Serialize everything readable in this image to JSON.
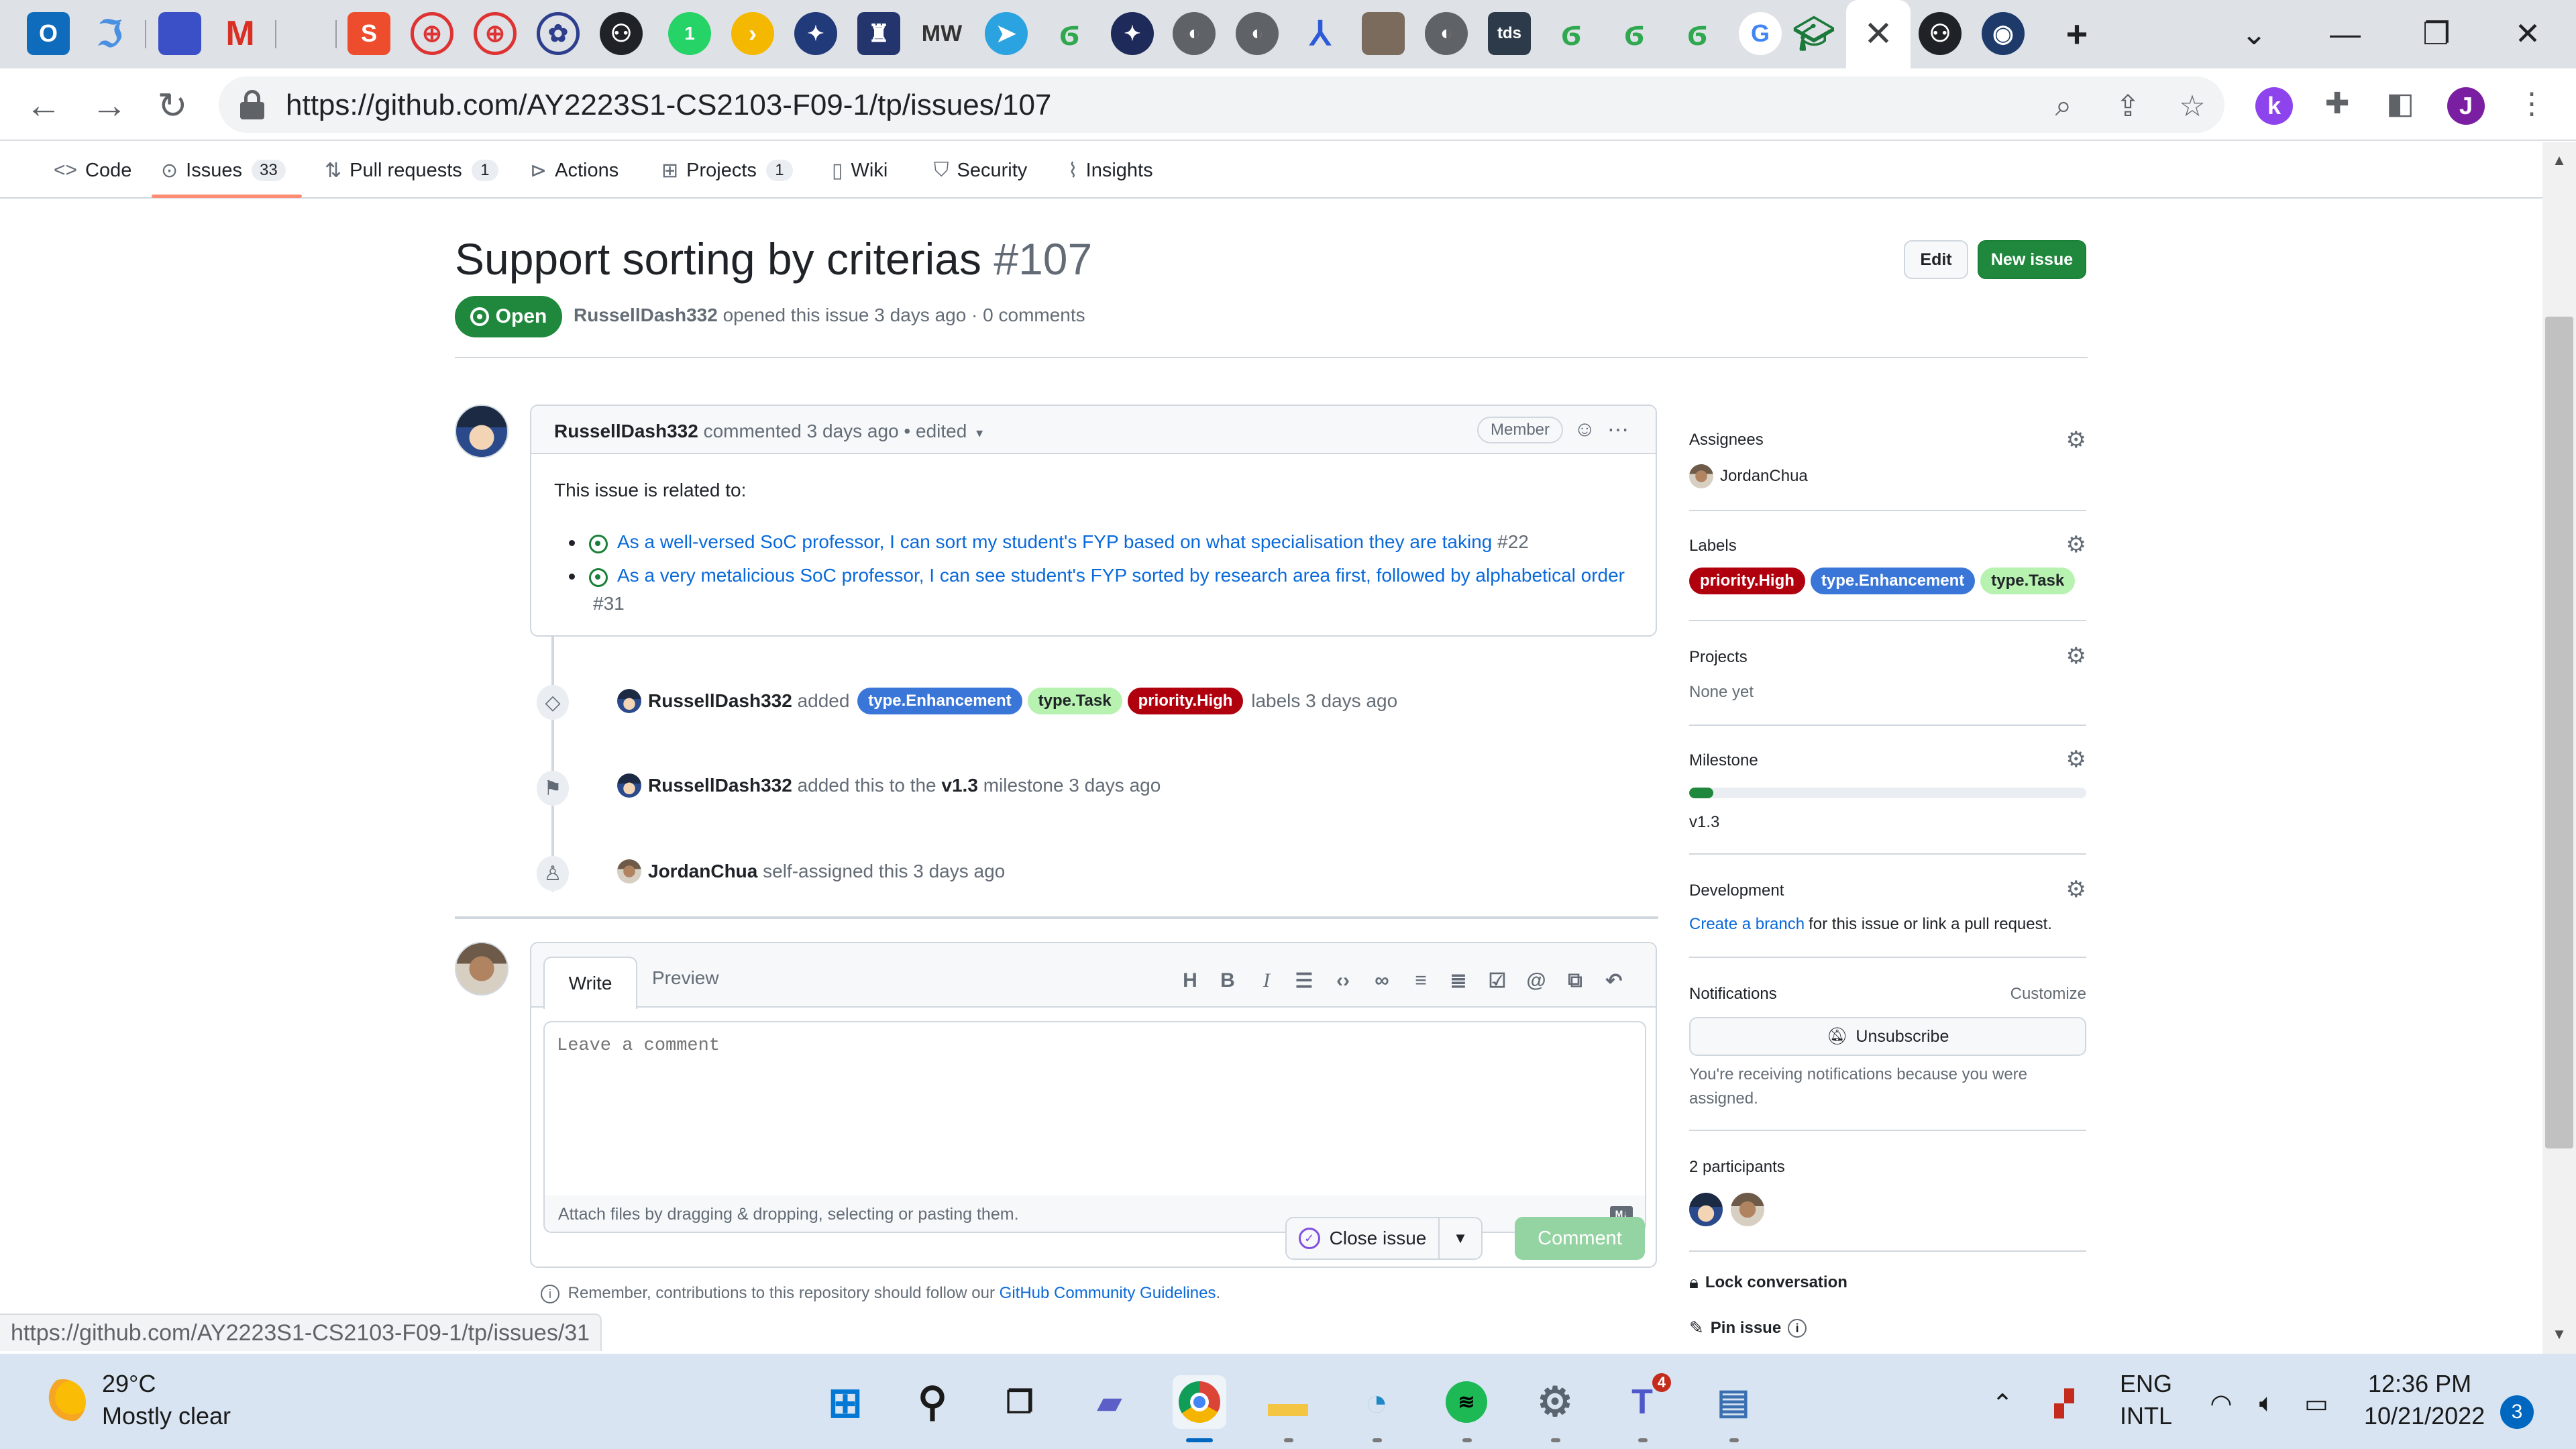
{
  "browser": {
    "url": "https://github.com/AY2223S1-CS2103-F09-1/tp/issues/107",
    "active_tab_close": "✕",
    "tab_favicons": [
      "outlook-icon",
      "translate-icon",
      "docs-icon",
      "gmail-icon",
      "shopee-icon",
      "lensa-icon",
      "lensa-icon",
      "nus-icon",
      "github-icon",
      "whatsapp-icon",
      "plex-icon",
      "wiki-icon",
      "nus-crest-icon",
      "mw-icon",
      "telegram-icon",
      "leaf-icon",
      "chess-icon",
      "globe-icon",
      "globe-icon",
      "linear-icon",
      "profile-icon",
      "globe-icon",
      "tds-icon",
      "leaf-icon",
      "leaf-icon",
      "leaf-icon",
      "google-icon",
      "graduation-cap-icon"
    ],
    "status_url": "https://github.com/AY2223S1-CS2103-F09-1/tp/issues/31",
    "profile_initial": "J",
    "ext_initial": "k",
    "tab_text_mw": "MW",
    "tab_text_tds": "tds"
  },
  "repo_nav": {
    "items": [
      {
        "label": "Code",
        "icon": "code-icon"
      },
      {
        "label": "Issues",
        "icon": "issue-icon",
        "count": "33"
      },
      {
        "label": "Pull requests",
        "icon": "pull-request-icon",
        "count": "1"
      },
      {
        "label": "Actions",
        "icon": "play-icon"
      },
      {
        "label": "Projects",
        "icon": "table-icon",
        "count": "1"
      },
      {
        "label": "Wiki",
        "icon": "book-icon"
      },
      {
        "label": "Security",
        "icon": "shield-icon"
      },
      {
        "label": "Insights",
        "icon": "graph-icon"
      }
    ]
  },
  "issue": {
    "title": "Support sorting by criterias",
    "number": "#107",
    "state": "Open",
    "author": "RussellDash332",
    "meta_rest": "opened this issue 3 days ago · 0 comments",
    "edit_label": "Edit",
    "new_issue_label": "New issue"
  },
  "comment": {
    "author": "RussellDash332",
    "meta": "commented 3 days ago • edited",
    "role": "Member",
    "intro": "This issue is related to:",
    "links": [
      {
        "text": "As a well-versed SoC professor, I can sort my student's FYP based on what specialisation they are taking",
        "ref": "#22"
      },
      {
        "text": "As a very metalicious SoC professor, I can see student's FYP sorted by research area first, followed by alphabetical order",
        "ref": "#31"
      }
    ]
  },
  "timeline": {
    "labels_event": {
      "actor": "RussellDash332",
      "verb": "added",
      "labels": [
        "type.Enhancement",
        "type.Task",
        "priority.High"
      ],
      "suffix": "labels 3 days ago"
    },
    "milestone_event": {
      "actor": "RussellDash332",
      "verb": "added this to the",
      "milestone": "v1.3",
      "suffix": "milestone 3 days ago"
    },
    "assign_event": {
      "actor": "JordanChua",
      "suffix": "self-assigned this 3 days ago"
    }
  },
  "new_comment": {
    "tab_write": "Write",
    "tab_preview": "Preview",
    "toolbar_icons": [
      "heading-icon",
      "bold-icon",
      "italic-icon",
      "quote-icon",
      "code-icon",
      "link-icon",
      "unordered-list-icon",
      "ordered-list-icon",
      "task-list-icon",
      "mention-icon",
      "cross-reference-icon",
      "reply-icon"
    ],
    "toolbar_glyphs": {
      "heading": "H",
      "bold": "B",
      "italic": "I"
    },
    "markdown_badge": "M↓",
    "placeholder": "Leave a comment",
    "attach_hint": "Attach files by dragging & dropping, selecting or pasting them.",
    "close_label": "Close issue",
    "comment_label": "Comment",
    "guidelines_prefix": "Remember, contributions to this repository should follow our",
    "guidelines_link": "GitHub Community Guidelines",
    "guidelines_suffix": "."
  },
  "sidebar": {
    "assignees": {
      "heading": "Assignees",
      "value": "JordanChua"
    },
    "labels": {
      "heading": "Labels",
      "items": [
        "priority.High",
        "type.Enhancement",
        "type.Task"
      ]
    },
    "projects": {
      "heading": "Projects",
      "value": "None yet"
    },
    "milestone": {
      "heading": "Milestone",
      "value": "v1.3",
      "progress_fraction": 0.06
    },
    "development": {
      "heading": "Development",
      "link": "Create a branch",
      "text": "for this issue or link a pull request."
    },
    "notifications": {
      "heading": "Notifications",
      "customize": "Customize",
      "button": "Unsubscribe",
      "reason": "You're receiving notifications because you were assigned."
    },
    "participants": {
      "heading": "2 participants"
    },
    "lock": "Lock conversation",
    "pin": "Pin issue"
  },
  "taskbar": {
    "temperature": "29°C",
    "weather": "Mostly clear",
    "language": "ENG",
    "layout": "INTL",
    "time": "12:36 PM",
    "date": "10/21/2022",
    "notifications": "3",
    "teams_badge": "4"
  },
  "colors": {
    "label_enhancement": "#3a76d8",
    "label_task": "#b8f2b0",
    "label_high": "#b0000e",
    "open_green": "#1f883d",
    "link_blue": "#0969da"
  }
}
